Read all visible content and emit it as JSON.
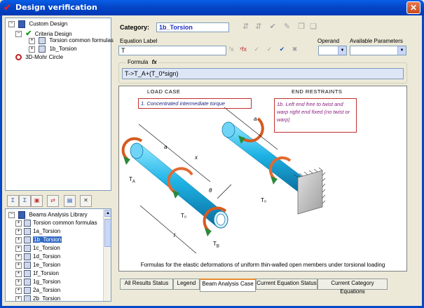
{
  "window": {
    "title": "Design verification",
    "close": "✕"
  },
  "top_tree": {
    "items": [
      {
        "label": "Custom Design"
      },
      {
        "label": "Criteria Design"
      },
      {
        "label": "Torsion common formulas"
      },
      {
        "label": "1b_Torsion"
      },
      {
        "label": "3D-Mohr Circle"
      }
    ]
  },
  "toolbar_left": {
    "close": "✕"
  },
  "library_tree": {
    "root": "Beams Analysis Library",
    "items": [
      "Torsion common formulas",
      "1a_Torsion",
      "1b_Torsion",
      "1c_Torsion",
      "1d_Torsion",
      "1e_Torsion",
      "1f_Torsion",
      "1g_Torsion",
      "2a_Torsion",
      "2b_Torsion"
    ],
    "selected_index": 2
  },
  "category": {
    "label": "Category:",
    "value": "1b_Torsion"
  },
  "equation": {
    "label_header": "Equation Label",
    "operand_header": "Operand",
    "params_header": "Available Parameters",
    "value": "T"
  },
  "formula": {
    "label": "Formula",
    "icon": "fx",
    "value": "T->T_A+(T_0*sign)"
  },
  "figure": {
    "load_case_title": "LOAD CASE",
    "end_restraints_title": "END RESTRAINTS",
    "load_note": "1. Concentrated intermediate torque",
    "restraint_note": "1b. Left end free to twist and warp right end fixed (no twist or warp)",
    "labels": {
      "a1": "a",
      "x": "x",
      "a2": "a",
      "theta": "θ",
      "ta": "T",
      "ta_sub": "A",
      "t0": "T₀",
      "tb": "T",
      "tb_sub": "B",
      "l": "l",
      "t0b": "T₀"
    },
    "caption": "Formulas for the elastic deformations of uniform thin-walled open members under torsional loading"
  },
  "tabs": [
    {
      "label": "All Results Status"
    },
    {
      "label": "Legend"
    },
    {
      "label": "Beam Analysis Case",
      "active": true
    },
    {
      "label": "Current Equation Status"
    },
    {
      "label": "Current Category Equations"
    }
  ]
}
